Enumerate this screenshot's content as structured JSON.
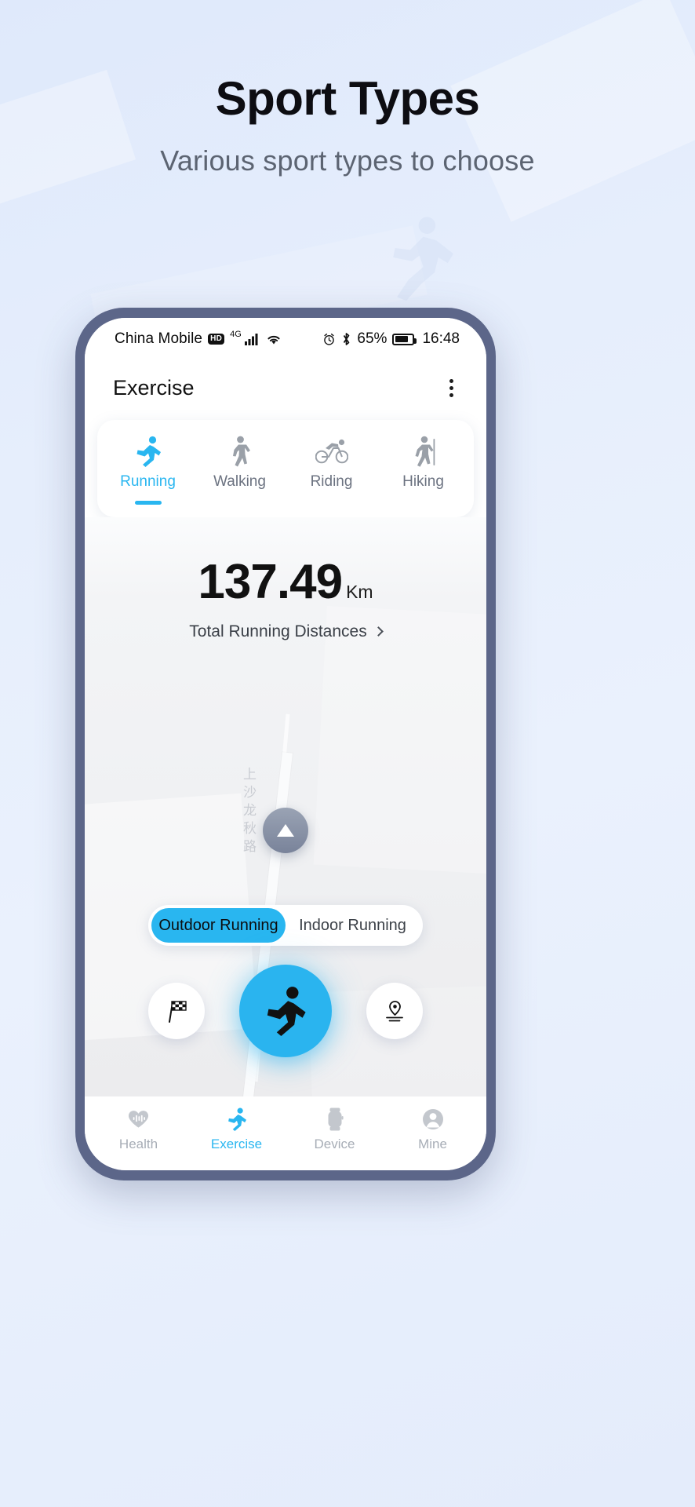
{
  "page": {
    "title": "Sport Types",
    "subtitle": "Various sport types to choose"
  },
  "colors": {
    "accent": "#29b6f0",
    "start_button": "#2ab4ef",
    "phone_frame": "#5c6689",
    "inactive_text": "#6b7280",
    "nav_inactive": "#a7adb6"
  },
  "status_bar": {
    "carrier": "China Mobile",
    "hd_badge": "HD",
    "network": "4G",
    "signal_icon": "signal-bars-icon",
    "wifi_icon": "wifi-icon",
    "alarm_icon": "alarm-clock-icon",
    "bluetooth_icon": "bluetooth-icon",
    "battery_percent": "65%",
    "battery_icon": "battery-icon",
    "time": "16:48"
  },
  "app_bar": {
    "title": "Exercise",
    "menu_icon": "kebab-menu-icon"
  },
  "sport_tabs": [
    {
      "label": "Running",
      "icon": "running-icon",
      "active": true
    },
    {
      "label": "Walking",
      "icon": "walking-icon",
      "active": false
    },
    {
      "label": "Riding",
      "icon": "cycling-icon",
      "active": false
    },
    {
      "label": "Hiking",
      "icon": "hiking-icon",
      "active": false
    }
  ],
  "distance": {
    "value": "137.49",
    "unit": "Km",
    "label": "Total Running Distances",
    "chevron_icon": "chevron-right-icon"
  },
  "map": {
    "street_label": "上沙龙秋路",
    "locate_icon": "locate-arrow-icon"
  },
  "mode_toggle": {
    "options": [
      {
        "label": "Outdoor Running",
        "active": true
      },
      {
        "label": "Indoor Running",
        "active": false
      }
    ]
  },
  "actions": {
    "goal_icon": "checkered-flag-icon",
    "start_icon": "running-icon",
    "route_icon": "route-pin-icon"
  },
  "bottom_nav": [
    {
      "label": "Health",
      "icon": "heart-pulse-icon",
      "active": false
    },
    {
      "label": "Exercise",
      "icon": "running-icon",
      "active": true
    },
    {
      "label": "Device",
      "icon": "watch-icon",
      "active": false
    },
    {
      "label": "Mine",
      "icon": "profile-icon",
      "active": false
    }
  ]
}
